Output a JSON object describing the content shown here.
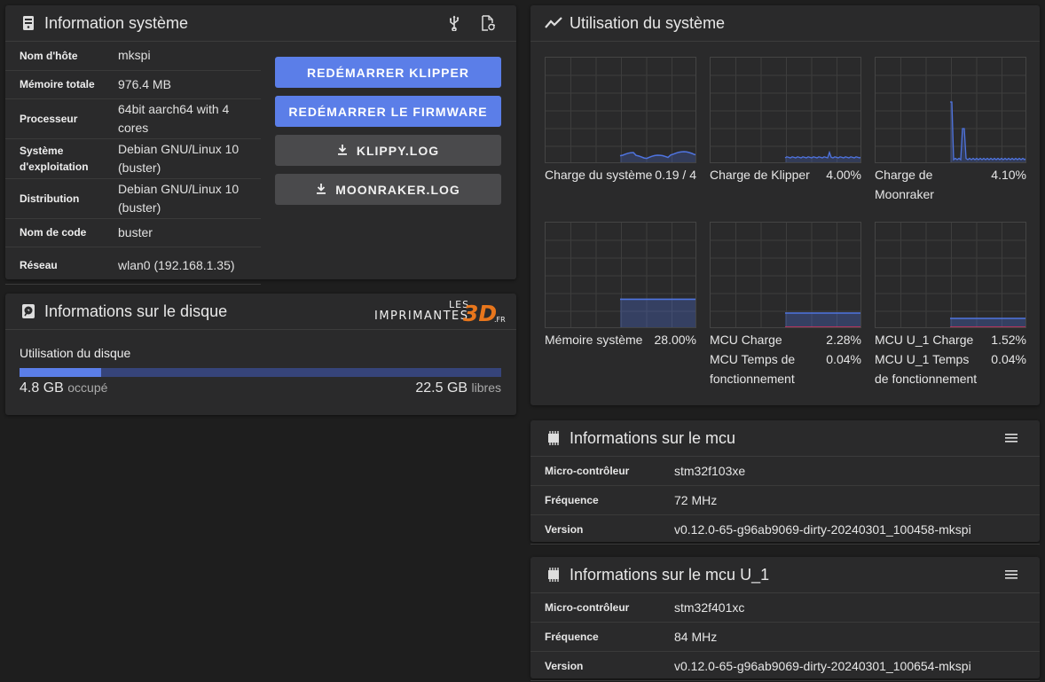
{
  "system_info": {
    "title": "Information système",
    "rows": [
      {
        "key": "Nom d'hôte",
        "value": "mkspi"
      },
      {
        "key": "Mémoire totale",
        "value": "976.4 MB"
      },
      {
        "key": "Processeur",
        "value": "64bit aarch64 with 4 cores"
      },
      {
        "key": "Système d'exploitation",
        "value": "Debian GNU/Linux 10 (buster)"
      },
      {
        "key": "Distribution",
        "value": "Debian GNU/Linux 10 (buster)"
      },
      {
        "key": "Nom de code",
        "value": "buster"
      },
      {
        "key": "Réseau",
        "value": "wlan0 (192.168.1.35)"
      }
    ],
    "buttons": {
      "restart_klipper": "REDÉMARRER KLIPPER",
      "restart_firmware": "REDÉMARRER LE FIRMWARE",
      "klippy_log": "KLIPPY.LOG",
      "moonraker_log": "MOONRAKER.LOG"
    }
  },
  "disk_info": {
    "title": "Informations sur le disque",
    "usage_label": "Utilisation du disque",
    "used": "4.8 GB",
    "used_suffix": "occupé",
    "free": "22.5 GB",
    "free_suffix": "libres",
    "used_fraction": 0.17,
    "watermark": {
      "top": "LES",
      "middle": "IMPRIMANTES",
      "brand": "3D",
      "suffix": ".FR"
    }
  },
  "system_usage": {
    "title": "Utilisation du système",
    "charts": [
      {
        "label": "Charge du système",
        "value": "0.19 / 4",
        "fill": 0.1,
        "kind": "wave"
      },
      {
        "label": "Charge de Klipper",
        "value": "4.00%",
        "fill": 0.04,
        "kind": "flat"
      },
      {
        "label": "Charge de Moonraker",
        "value": "4.10%",
        "fill": 0.04,
        "kind": "spikes"
      },
      {
        "label": "Mémoire système",
        "value": "28.00%",
        "fill": 0.28,
        "kind": "block"
      },
      {
        "label": "MCU Charge",
        "value": "2.28%",
        "label2": "MCU Temps de fonctionnement",
        "value2": "0.04%",
        "fill": 0.15,
        "kind": "mcu"
      },
      {
        "label": "MCU U_1 Charge",
        "value": "1.52%",
        "label2": "MCU U_1 Temps de fonctionnement",
        "value2": "0.04%",
        "fill": 0.1,
        "kind": "mcu"
      }
    ]
  },
  "mcu": {
    "title": "Informations sur le mcu",
    "rows": [
      {
        "key": "Micro-contrôleur",
        "value": "stm32f103xe"
      },
      {
        "key": "Fréquence",
        "value": "72 MHz"
      },
      {
        "key": "Version",
        "value": "v0.12.0-65-g96ab9069-dirty-20240301_100458-mkspi"
      }
    ]
  },
  "mcu_u1": {
    "title": "Informations sur le mcu U_1",
    "rows": [
      {
        "key": "Micro-contrôleur",
        "value": "stm32f401xc"
      },
      {
        "key": "Fréquence",
        "value": "84 MHz"
      },
      {
        "key": "Version",
        "value": "v0.12.0-65-g96ab9069-dirty-20240301_100654-mkspi"
      }
    ]
  },
  "colors": {
    "accent": "#5b7ee8",
    "chart_line": "#4f74e0",
    "mcu_line": "#e0305a"
  },
  "icons": [
    "computer-tower-icon",
    "usb-icon",
    "file-refresh-icon",
    "chart-line-icon",
    "harddisk-icon",
    "download-icon",
    "memory-chip-icon",
    "menu-icon"
  ]
}
